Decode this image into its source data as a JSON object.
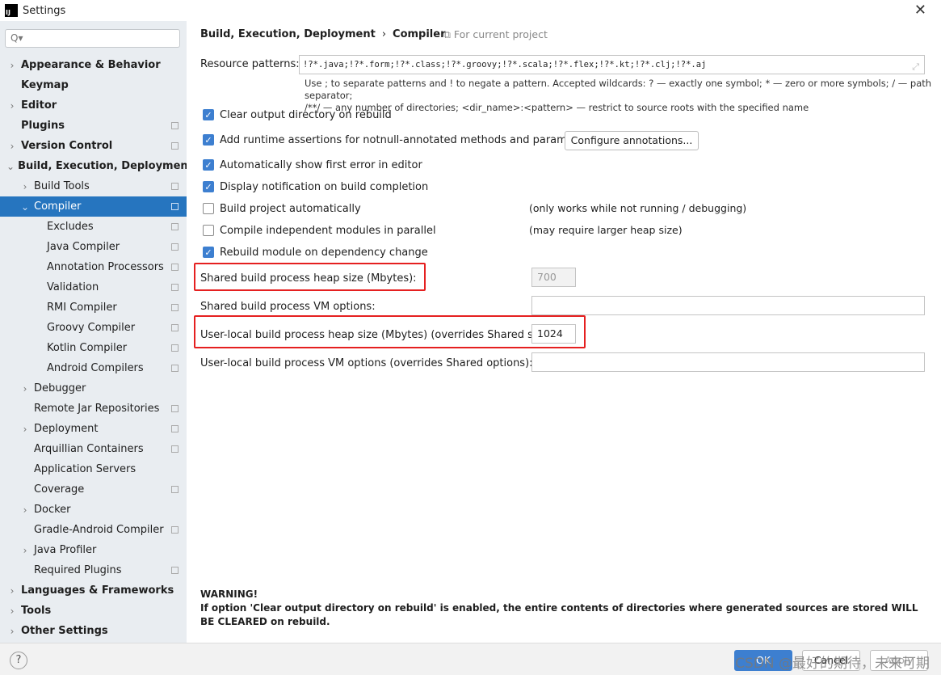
{
  "window": {
    "title": "Settings",
    "logo": "IJ"
  },
  "search": {
    "placeholder": "Q▾"
  },
  "sidebar": {
    "items": [
      {
        "label": "Appearance & Behavior",
        "level": 0,
        "arrow": "right",
        "bold": true,
        "project": false
      },
      {
        "label": "Keymap",
        "level": 0,
        "arrow": "none",
        "bold": true,
        "project": false
      },
      {
        "label": "Editor",
        "level": 0,
        "arrow": "right",
        "bold": true,
        "project": false
      },
      {
        "label": "Plugins",
        "level": 0,
        "arrow": "none",
        "bold": true,
        "project": true
      },
      {
        "label": "Version Control",
        "level": 0,
        "arrow": "right",
        "bold": true,
        "project": true
      },
      {
        "label": "Build, Execution, Deployment",
        "level": 0,
        "arrow": "down",
        "bold": true,
        "project": false
      },
      {
        "label": "Build Tools",
        "level": 1,
        "arrow": "right",
        "bold": false,
        "project": true
      },
      {
        "label": "Compiler",
        "level": 1,
        "arrow": "down",
        "bold": false,
        "project": true,
        "selected": true
      },
      {
        "label": "Excludes",
        "level": 2,
        "arrow": "none",
        "bold": false,
        "project": true
      },
      {
        "label": "Java Compiler",
        "level": 2,
        "arrow": "none",
        "bold": false,
        "project": true
      },
      {
        "label": "Annotation Processors",
        "level": 2,
        "arrow": "none",
        "bold": false,
        "project": true
      },
      {
        "label": "Validation",
        "level": 2,
        "arrow": "none",
        "bold": false,
        "project": true
      },
      {
        "label": "RMI Compiler",
        "level": 2,
        "arrow": "none",
        "bold": false,
        "project": true
      },
      {
        "label": "Groovy Compiler",
        "level": 2,
        "arrow": "none",
        "bold": false,
        "project": true
      },
      {
        "label": "Kotlin Compiler",
        "level": 2,
        "arrow": "none",
        "bold": false,
        "project": true
      },
      {
        "label": "Android Compilers",
        "level": 2,
        "arrow": "none",
        "bold": false,
        "project": true
      },
      {
        "label": "Debugger",
        "level": 1,
        "arrow": "right",
        "bold": false,
        "project": false
      },
      {
        "label": "Remote Jar Repositories",
        "level": 1,
        "arrow": "none",
        "bold": false,
        "project": true
      },
      {
        "label": "Deployment",
        "level": 1,
        "arrow": "right",
        "bold": false,
        "project": true
      },
      {
        "label": "Arquillian Containers",
        "level": 1,
        "arrow": "none",
        "bold": false,
        "project": true
      },
      {
        "label": "Application Servers",
        "level": 1,
        "arrow": "none",
        "bold": false,
        "project": false
      },
      {
        "label": "Coverage",
        "level": 1,
        "arrow": "none",
        "bold": false,
        "project": true
      },
      {
        "label": "Docker",
        "level": 1,
        "arrow": "right",
        "bold": false,
        "project": false
      },
      {
        "label": "Gradle-Android Compiler",
        "level": 1,
        "arrow": "none",
        "bold": false,
        "project": true
      },
      {
        "label": "Java Profiler",
        "level": 1,
        "arrow": "right",
        "bold": false,
        "project": false
      },
      {
        "label": "Required Plugins",
        "level": 1,
        "arrow": "none",
        "bold": false,
        "project": true
      },
      {
        "label": "Languages & Frameworks",
        "level": 0,
        "arrow": "right",
        "bold": true,
        "project": false
      },
      {
        "label": "Tools",
        "level": 0,
        "arrow": "right",
        "bold": true,
        "project": false
      },
      {
        "label": "Other Settings",
        "level": 0,
        "arrow": "right",
        "bold": true,
        "project": false
      }
    ]
  },
  "main": {
    "breadcrumb": [
      "Build, Execution, Deployment",
      "Compiler"
    ],
    "breadcrumb_sep": "›",
    "for_current_project": "For current project",
    "resource_patterns_label": "Resource patterns:",
    "resource_patterns_value": "!?*.java;!?*.form;!?*.class;!?*.groovy;!?*.scala;!?*.flex;!?*.kt;!?*.clj;!?*.aj",
    "hint_line1": "Use ; to separate patterns and ! to negate a pattern. Accepted wildcards: ? — exactly one symbol; * — zero or more symbols; / — path separator;",
    "hint_line2": "/**/ — any number of directories; <dir_name>:<pattern> — restrict to source roots with the specified name",
    "checkboxes": [
      {
        "label": "Clear output directory on rebuild",
        "checked": true
      },
      {
        "label": "Add runtime assertions for notnull-annotated methods and parameters",
        "checked": true
      },
      {
        "label": "Automatically show first error in editor",
        "checked": true
      },
      {
        "label": "Display notification on build completion",
        "checked": true
      },
      {
        "label": "Build project automatically",
        "checked": false,
        "note": "(only works while not running / debugging)"
      },
      {
        "label": "Compile independent modules in parallel",
        "checked": false,
        "note": "(may require larger heap size)"
      },
      {
        "label": "Rebuild module on dependency change",
        "checked": true
      }
    ],
    "configure_annotations": "Configure annotations...",
    "fields": [
      {
        "label": "Shared build process heap size (Mbytes):",
        "value": "700",
        "disabled": true,
        "highlight": true
      },
      {
        "label": "Shared build process VM options:",
        "value": ""
      },
      {
        "label": "User-local build process heap size (Mbytes) (overrides Shared size):",
        "value": "1024",
        "highlight": true
      },
      {
        "label": "User-local build process VM options (overrides Shared options):",
        "value": ""
      }
    ],
    "warning_title": "WARNING!",
    "warning_text": "If option 'Clear output directory on rebuild' is enabled, the entire contents of directories where generated sources are stored WILL BE CLEARED on rebuild."
  },
  "footer": {
    "help": "?",
    "ok": "OK",
    "cancel": "Cancel",
    "apply": "Apply",
    "watermark": "CSDN @最好的期待，未来可期"
  },
  "colors": {
    "accent": "#2675bf",
    "checkbox": "#3d7fd0",
    "highlight": "#e52020"
  }
}
